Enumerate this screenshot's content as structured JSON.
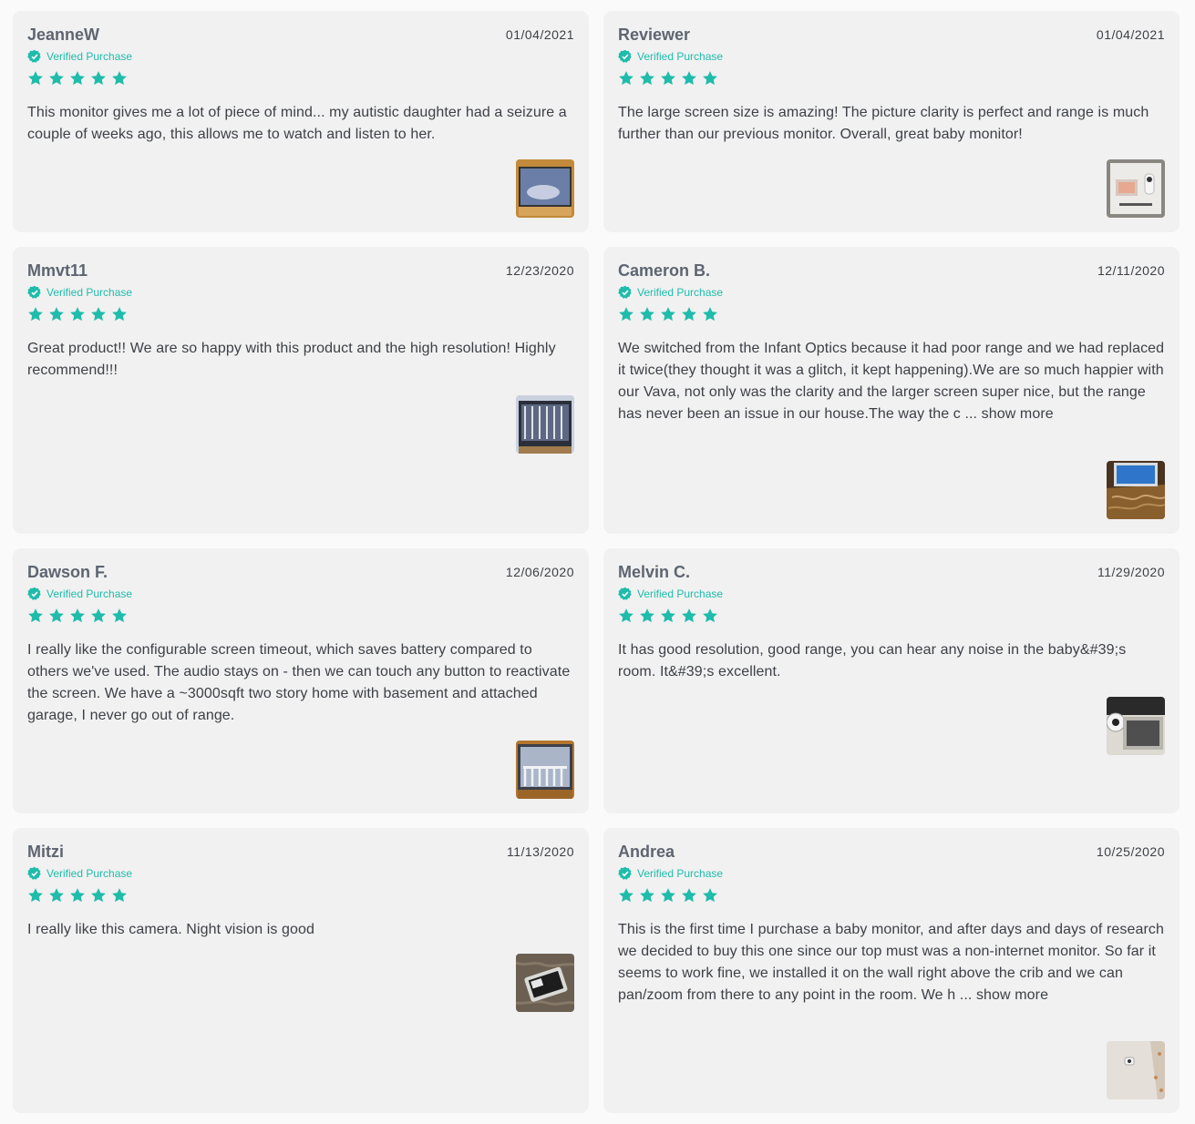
{
  "verified_label": "Verified Purchase",
  "accent_color": "#1fbcab",
  "rating_max": 5,
  "reviews": [
    {
      "name": "JeanneW",
      "date": "01/04/2021",
      "rating": 5,
      "verified": true,
      "text": "This monitor gives me a lot of piece of mind... my autistic daughter had a seizure a couple of weeks ago, this allows me to watch and listen to her.",
      "thumb": "review-photo-monitor-sleeping-child"
    },
    {
      "name": "Reviewer",
      "date": "01/04/2021",
      "rating": 5,
      "verified": true,
      "text": "The large screen size is amazing! The picture clarity is perfect and range is much further than our previous monitor. Overall, great baby monitor!",
      "thumb": "review-photo-product-box"
    },
    {
      "name": "Mmvt11",
      "date": "12/23/2020",
      "rating": 5,
      "verified": true,
      "text": "Great product!! We are so happy with this product and the high resolution! Highly recommend!!!",
      "thumb": "review-photo-monitor-crib"
    },
    {
      "name": "Cameron B.",
      "date": "12/11/2020",
      "rating": 5,
      "verified": true,
      "text": "We switched from the Infant Optics because it had poor range and we had replaced it twice(they thought it was a glitch, it kept happening).We are so much happier with our Vava, not only was the clarity and the larger screen super nice, but the range has never been an issue in our house.The way the c ... show more",
      "thumb": "review-photo-monitor-on-counter"
    },
    {
      "name": "Dawson F.",
      "date": "12/06/2020",
      "rating": 5,
      "verified": true,
      "text": "I really like the configurable screen timeout, which saves battery compared to others we've used.  The audio stays on - then we can touch any button to reactivate the screen.  We have a ~3000sqft two story home with basement and attached garage, I never go out of range.",
      "thumb": "review-photo-monitor-crib-view"
    },
    {
      "name": "Melvin C.",
      "date": "11/29/2020",
      "rating": 5,
      "verified": true,
      "text": "It has good resolution, good range, you can hear any noise in the baby&#39;s room. It&#39;s excellent.",
      "thumb": "review-photo-camera-and-monitor"
    },
    {
      "name": "Mitzi",
      "date": "11/13/2020",
      "rating": 5,
      "verified": true,
      "text": "I really like this camera. Night vision is good",
      "thumb": "review-photo-monitor-on-carpet"
    },
    {
      "name": "Andrea",
      "date": "10/25/2020",
      "rating": 5,
      "verified": true,
      "text": "This is the first time I purchase a baby monitor, and after days and days of research we decided to buy this one since our top must was a non-internet monitor. So far it seems to work fine, we installed it on the wall right above the crib and we can pan/zoom from there to any point in the room. We h ... show more",
      "thumb": "review-photo-camera-on-wall"
    }
  ]
}
